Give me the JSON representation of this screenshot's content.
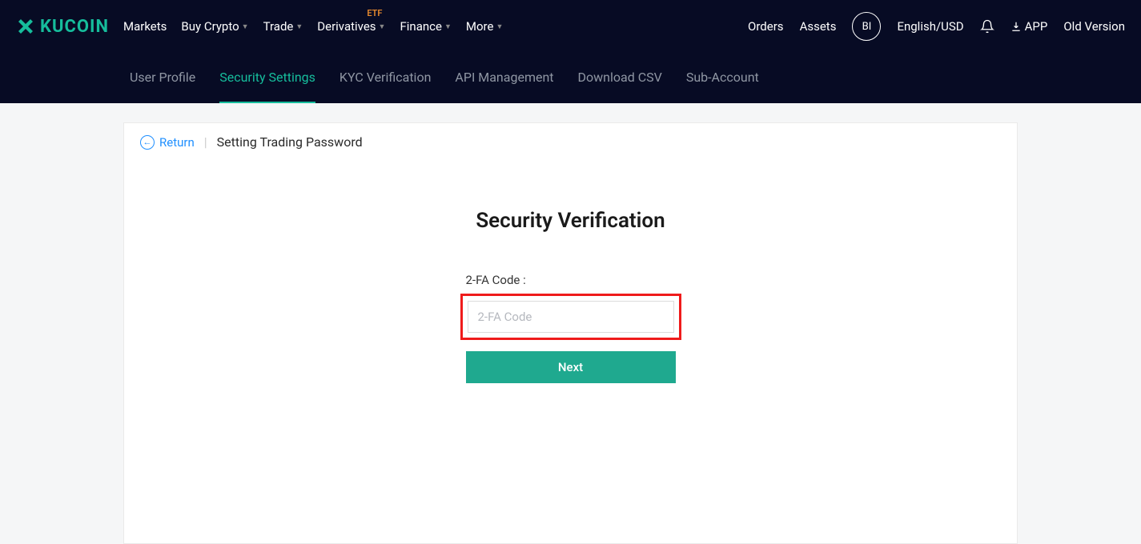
{
  "brand": "KUCOIN",
  "nav": {
    "markets": "Markets",
    "buyCrypto": "Buy Crypto",
    "trade": "Trade",
    "derivatives": "Derivatives",
    "etfBadge": "ETF",
    "finance": "Finance",
    "more": "More"
  },
  "headerRight": {
    "orders": "Orders",
    "assets": "Assets",
    "avatar": "BI",
    "language": "English/USD",
    "app": "APP",
    "oldVersion": "Old Version"
  },
  "subNav": {
    "userProfile": "User Profile",
    "securitySettings": "Security Settings",
    "kyc": "KYC Verification",
    "api": "API Management",
    "downloadCsv": "Download CSV",
    "subAccount": "Sub-Account"
  },
  "panel": {
    "return": "Return",
    "title": "Setting Trading Password"
  },
  "form": {
    "heading": "Security Verification",
    "label": "2-FA Code :",
    "placeholder": "2-FA Code",
    "button": "Next"
  }
}
